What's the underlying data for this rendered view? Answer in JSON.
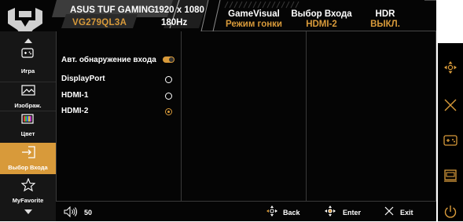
{
  "header": {
    "model_line1": "ASUS TUF GAMING",
    "model_line2": "VG279QL3A",
    "resolution": "1920 x 1080",
    "refresh_rate": "180Hz",
    "columns": [
      {
        "title": "GameVisual",
        "value": "Режим гонки"
      },
      {
        "title": "Выбор Входа",
        "value": "HDMI-2"
      },
      {
        "title": "HDR",
        "value": "ВЫКЛ."
      }
    ]
  },
  "nav": {
    "items": [
      {
        "label": "Игра",
        "icon": "gamepad-icon"
      },
      {
        "label": "Изображ.",
        "icon": "image-icon"
      },
      {
        "label": "Цвет",
        "icon": "color-bars-icon"
      },
      {
        "label": "Выбор Входа",
        "icon": "input-select-icon",
        "active": true
      },
      {
        "label": "MyFavorite",
        "icon": "star-icon"
      }
    ]
  },
  "menu": {
    "options": [
      {
        "label": "Авт. обнаружение входа",
        "control": "toggle",
        "on": true
      },
      {
        "label": "DisplayPort",
        "control": "radio",
        "selected": false
      },
      {
        "label": "HDMI-1",
        "control": "radio",
        "selected": false
      },
      {
        "label": "HDMI-2",
        "control": "radio",
        "selected": true
      }
    ]
  },
  "footer": {
    "volume": "50",
    "back": "Back",
    "enter": "Enter",
    "exit": "Exit"
  },
  "colors": {
    "accent": "#d89a3a",
    "background": "#050505",
    "nav_background": "#161616"
  }
}
